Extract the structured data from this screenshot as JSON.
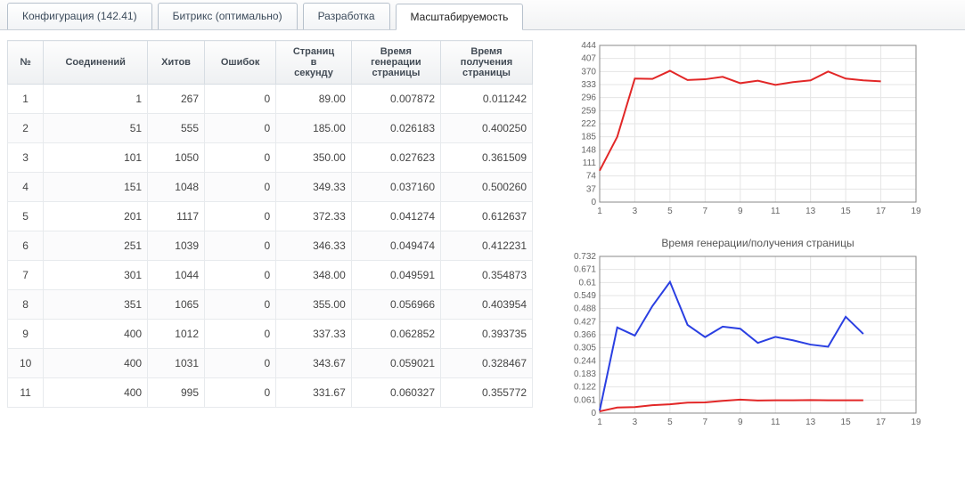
{
  "tabs": {
    "items": [
      {
        "label": "Конфигурация (142.41)"
      },
      {
        "label": "Битрикс (оптимально)"
      },
      {
        "label": "Разработка"
      },
      {
        "label": "Масштабируемость"
      }
    ],
    "active_index": 3
  },
  "table": {
    "headers": {
      "n": "№",
      "conn": "Соединений",
      "hits": "Хитов",
      "err": "Ошибок",
      "pps": "Страниц в секунду",
      "gen": "Время генерации страницы",
      "recv": "Время получения страницы"
    },
    "rows": [
      {
        "n": "1",
        "conn": "1",
        "hits": "267",
        "err": "0",
        "pps": "89.00",
        "gen": "0.007872",
        "recv": "0.011242"
      },
      {
        "n": "2",
        "conn": "51",
        "hits": "555",
        "err": "0",
        "pps": "185.00",
        "gen": "0.026183",
        "recv": "0.400250"
      },
      {
        "n": "3",
        "conn": "101",
        "hits": "1050",
        "err": "0",
        "pps": "350.00",
        "gen": "0.027623",
        "recv": "0.361509"
      },
      {
        "n": "4",
        "conn": "151",
        "hits": "1048",
        "err": "0",
        "pps": "349.33",
        "gen": "0.037160",
        "recv": "0.500260"
      },
      {
        "n": "5",
        "conn": "201",
        "hits": "1117",
        "err": "0",
        "pps": "372.33",
        "gen": "0.041274",
        "recv": "0.612637"
      },
      {
        "n": "6",
        "conn": "251",
        "hits": "1039",
        "err": "0",
        "pps": "346.33",
        "gen": "0.049474",
        "recv": "0.412231"
      },
      {
        "n": "7",
        "conn": "301",
        "hits": "1044",
        "err": "0",
        "pps": "348.00",
        "gen": "0.049591",
        "recv": "0.354873"
      },
      {
        "n": "8",
        "conn": "351",
        "hits": "1065",
        "err": "0",
        "pps": "355.00",
        "gen": "0.056966",
        "recv": "0.403954"
      },
      {
        "n": "9",
        "conn": "400",
        "hits": "1012",
        "err": "0",
        "pps": "337.33",
        "gen": "0.062852",
        "recv": "0.393735"
      },
      {
        "n": "10",
        "conn": "400",
        "hits": "1031",
        "err": "0",
        "pps": "343.67",
        "gen": "0.059021",
        "recv": "0.328467"
      },
      {
        "n": "11",
        "conn": "400",
        "hits": "995",
        "err": "0",
        "pps": "331.67",
        "gen": "0.060327",
        "recv": "0.355772"
      }
    ]
  },
  "chart_data": [
    {
      "type": "line",
      "title": "",
      "xlabel": "",
      "ylabel": "",
      "ylim": [
        0,
        444
      ],
      "yticks": [
        0,
        37,
        74,
        111,
        148,
        185,
        222,
        259,
        296,
        333,
        370,
        407,
        444
      ],
      "xticks": [
        1,
        3,
        5,
        7,
        9,
        11,
        13,
        15,
        17,
        19
      ],
      "x": [
        1,
        2,
        3,
        4,
        5,
        6,
        7,
        8,
        9,
        10,
        11,
        12,
        13,
        14,
        15,
        16,
        17
      ],
      "series": [
        {
          "name": "pages_per_sec",
          "color": "#e22727",
          "values": [
            89,
            185,
            350,
            349,
            372,
            346,
            348,
            355,
            337,
            344,
            332,
            340,
            345,
            370,
            350,
            345,
            342
          ]
        }
      ]
    },
    {
      "type": "line",
      "title": "Время генерации/получения страницы",
      "xlabel": "",
      "ylabel": "",
      "ylim": [
        0,
        0.732
      ],
      "yticks": [
        0,
        0.061,
        0.122,
        0.183,
        0.244,
        0.305,
        0.366,
        0.427,
        0.488,
        0.549,
        0.61,
        0.671,
        0.732
      ],
      "xticks": [
        1,
        3,
        5,
        7,
        9,
        11,
        13,
        15,
        17,
        19
      ],
      "x": [
        1,
        2,
        3,
        4,
        5,
        6,
        7,
        8,
        9,
        10,
        11,
        12,
        13,
        14,
        15,
        16
      ],
      "series": [
        {
          "name": "recv",
          "color": "#2a3fe2",
          "values": [
            0.011,
            0.4,
            0.362,
            0.5,
            0.613,
            0.412,
            0.355,
            0.404,
            0.394,
            0.328,
            0.356,
            0.34,
            0.32,
            0.31,
            0.45,
            0.37
          ]
        },
        {
          "name": "gen",
          "color": "#e22727",
          "values": [
            0.008,
            0.026,
            0.028,
            0.037,
            0.041,
            0.049,
            0.05,
            0.057,
            0.063,
            0.059,
            0.06,
            0.06,
            0.061,
            0.06,
            0.06,
            0.06
          ]
        }
      ]
    }
  ]
}
